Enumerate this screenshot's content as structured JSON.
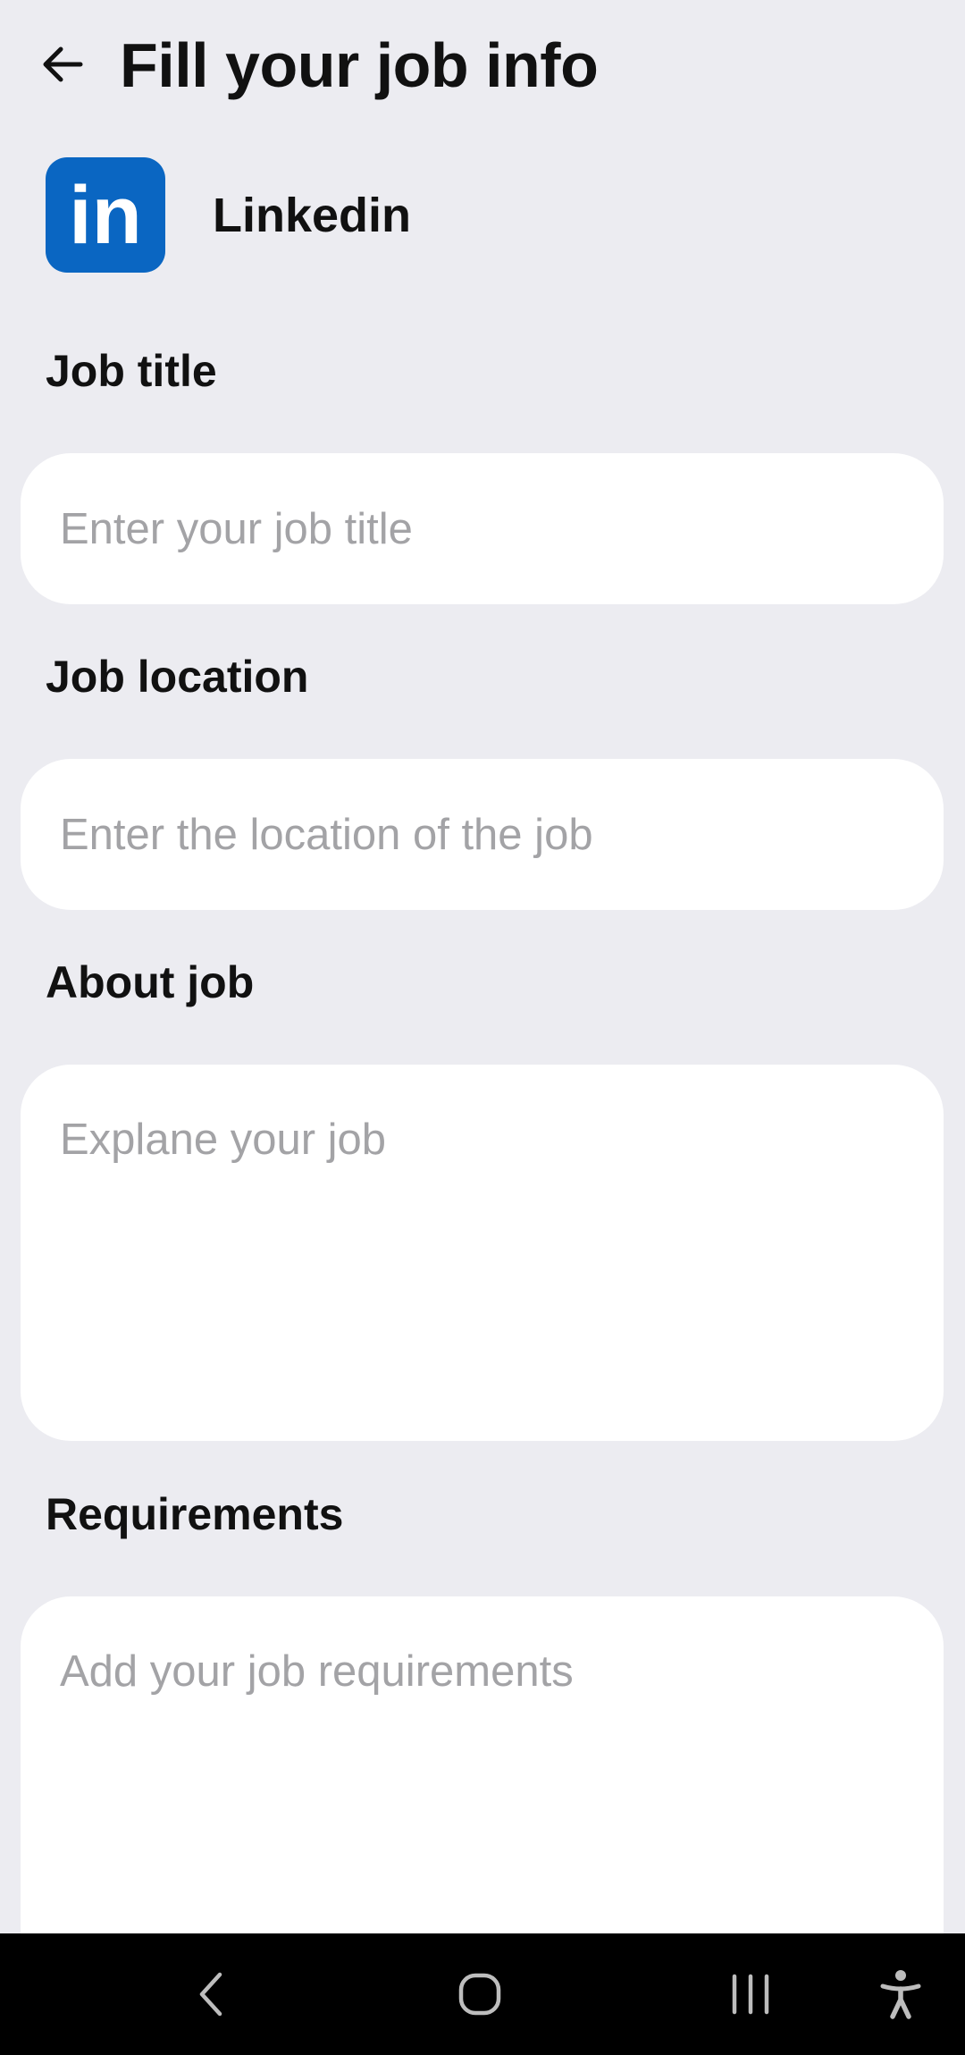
{
  "header": {
    "title": "Fill your job info",
    "back_icon": "arrow-left-icon"
  },
  "company": {
    "logo_text": "in",
    "name": "Linkedin",
    "brand_color": "#0A66C2"
  },
  "form": {
    "job_title": {
      "label": "Job title",
      "placeholder": "Enter your job title",
      "value": ""
    },
    "job_location": {
      "label": "Job location",
      "placeholder": "Enter the location of the job",
      "value": ""
    },
    "about_job": {
      "label": "About job",
      "placeholder": "Explane your job",
      "value": ""
    },
    "requirements": {
      "label": "Requirements",
      "placeholder": "Add your job requirements",
      "value": ""
    }
  },
  "system_nav": {
    "back_icon": "nav-back-icon",
    "home_icon": "nav-home-icon",
    "recents_icon": "nav-recents-icon",
    "accessibility_icon": "accessibility-icon"
  },
  "colors": {
    "background": "#ECECF1",
    "field_background": "#FFFFFF",
    "placeholder": "#A3A3A6"
  }
}
